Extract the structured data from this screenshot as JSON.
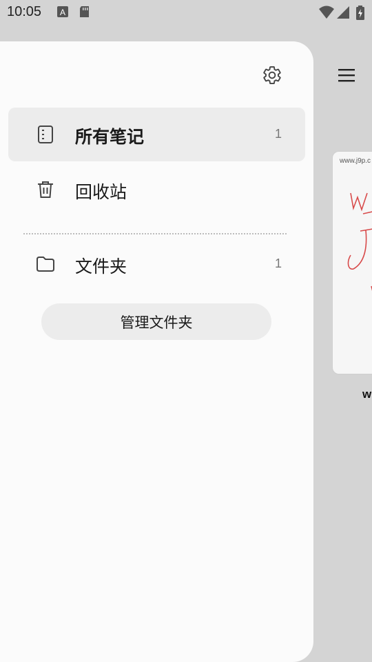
{
  "status_bar": {
    "time": "10:05",
    "icons": [
      "font-a-icon",
      "sd-card-icon",
      "wifi-icon",
      "signal-icon",
      "battery-charging-icon"
    ]
  },
  "background": {
    "menu_icon": "hamburger-menu-icon",
    "note_card": {
      "url_text": "www.j9p.c",
      "title_fragment": "w"
    }
  },
  "drawer": {
    "settings_icon": "gear-icon",
    "items": [
      {
        "label": "所有笔记",
        "count": "1",
        "icon": "notebook-icon",
        "selected": true
      },
      {
        "label": "回收站",
        "count": "",
        "icon": "trash-icon",
        "selected": false
      }
    ],
    "folders": [
      {
        "label": "文件夹",
        "count": "1",
        "icon": "folder-icon"
      }
    ],
    "manage_button": "管理文件夹"
  },
  "colors": {
    "scrim": "#d4d4d4",
    "drawer_bg": "#fbfbfb",
    "selected_bg": "#ececec",
    "handwriting": "#d84a4a"
  }
}
